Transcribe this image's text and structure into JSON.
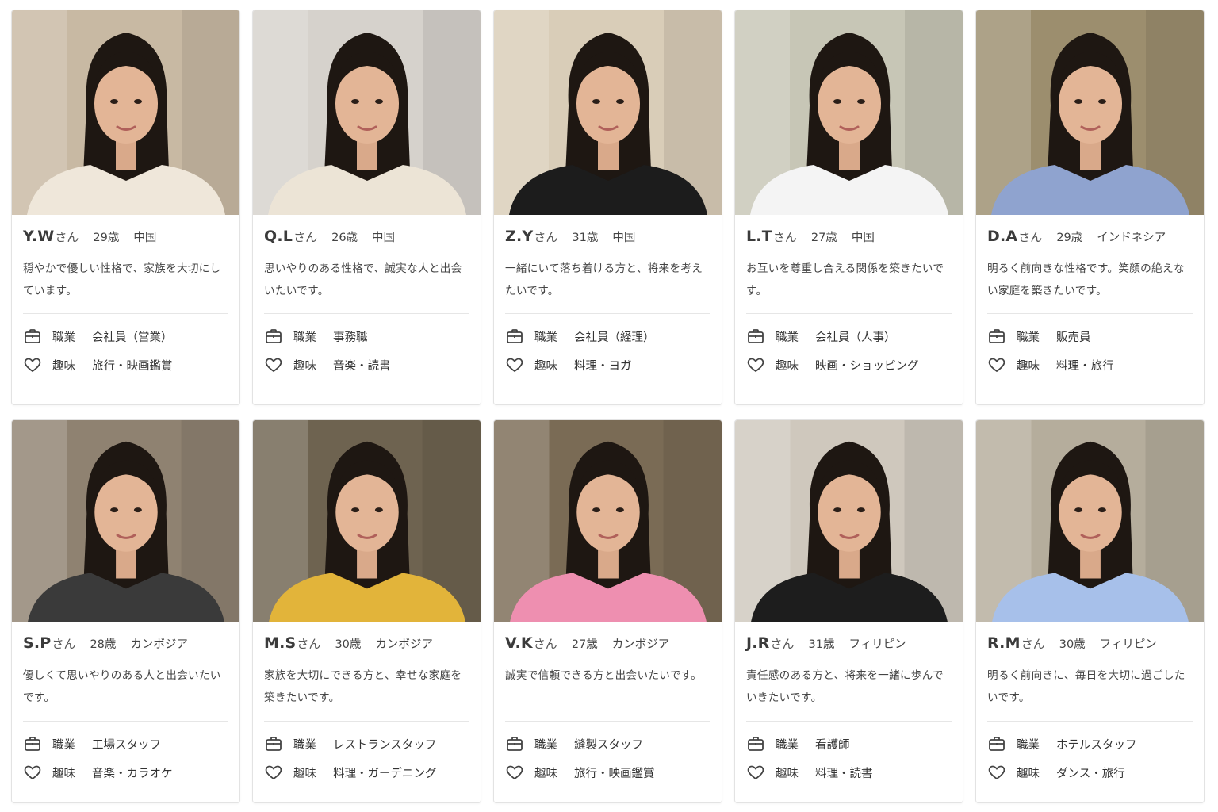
{
  "labels": {
    "occupation": "職業",
    "hobby": "趣味"
  },
  "icons": {
    "occupation": "briefcase-icon",
    "hobby": "heart-icon"
  },
  "profiles": [
    {
      "name": "Y.W",
      "honorific": "さん",
      "age": "29歳",
      "country": "中国",
      "description": "穏やかで優しい性格で、家族を大切にしています。",
      "occupation": "会社員（営業）",
      "hobby": "旅行・映画鑑賞"
    },
    {
      "name": "Q.L",
      "honorific": "さん",
      "age": "26歳",
      "country": "中国",
      "description": "思いやりのある性格で、誠実な人と出会いたいです。",
      "occupation": "事務職",
      "hobby": "音楽・読書"
    },
    {
      "name": "Z.Y",
      "honorific": "さん",
      "age": "31歳",
      "country": "中国",
      "description": "一緒にいて落ち着ける方と、将来を考えたいです。",
      "occupation": "会社員（経理）",
      "hobby": "料理・ヨガ"
    },
    {
      "name": "L.T",
      "honorific": "さん",
      "age": "27歳",
      "country": "中国",
      "description": "お互いを尊重し合える関係を築きたいです。",
      "occupation": "会社員（人事）",
      "hobby": "映画・ショッピング"
    },
    {
      "name": "D.A",
      "honorific": "さん",
      "age": "29歳",
      "country": "インドネシア",
      "description": "明るく前向きな性格です。笑顔の絶えない家庭を築きたいです。",
      "occupation": "販売員",
      "hobby": "料理・旅行"
    },
    {
      "name": "S.P",
      "honorific": "さん",
      "age": "28歳",
      "country": "カンボジア",
      "description": "優しくて思いやりのある人と出会いたいです。",
      "occupation": "工場スタッフ",
      "hobby": "音楽・カラオケ"
    },
    {
      "name": "M.S",
      "honorific": "さん",
      "age": "30歳",
      "country": "カンボジア",
      "description": "家族を大切にできる方と、幸せな家庭を築きたいです。",
      "occupation": "レストランスタッフ",
      "hobby": "料理・ガーデニング"
    },
    {
      "name": "V.K",
      "honorific": "さん",
      "age": "27歳",
      "country": "カンボジア",
      "description": "誠実で信頼できる方と出会いたいです。",
      "occupation": "縫製スタッフ",
      "hobby": "旅行・映画鑑賞"
    },
    {
      "name": "J.R",
      "honorific": "さん",
      "age": "31歳",
      "country": "フィリピン",
      "description": "責任感のある方と、将来を一緒に歩んでいきたいです。",
      "occupation": "看護師",
      "hobby": "料理・読書"
    },
    {
      "name": "R.M",
      "honorific": "さん",
      "age": "30歳",
      "country": "フィリピン",
      "description": "明るく前向きに、毎日を大切に過ごしたいです。",
      "occupation": "ホテルスタッフ",
      "hobby": "ダンス・旅行"
    }
  ],
  "colors": {
    "border": "#e3e3e3",
    "text": "#333333",
    "shirts": [
      "#efe7da",
      "#ece4d6",
      "#1c1c1c",
      "#f4f4f4",
      "#8fa3cf",
      "#3a3a3a",
      "#e2b43a",
      "#ee8fb0",
      "#1d1d1d",
      "#a7c0ea"
    ],
    "backgrounds": [
      "#c8b9a3",
      "#d6d2cc",
      "#d9cdb8",
      "#c7c6b6",
      "#9c8e6e",
      "#8f8271",
      "#6e6350",
      "#7a6b55",
      "#cfc8bd",
      "#b5ad9c"
    ]
  }
}
